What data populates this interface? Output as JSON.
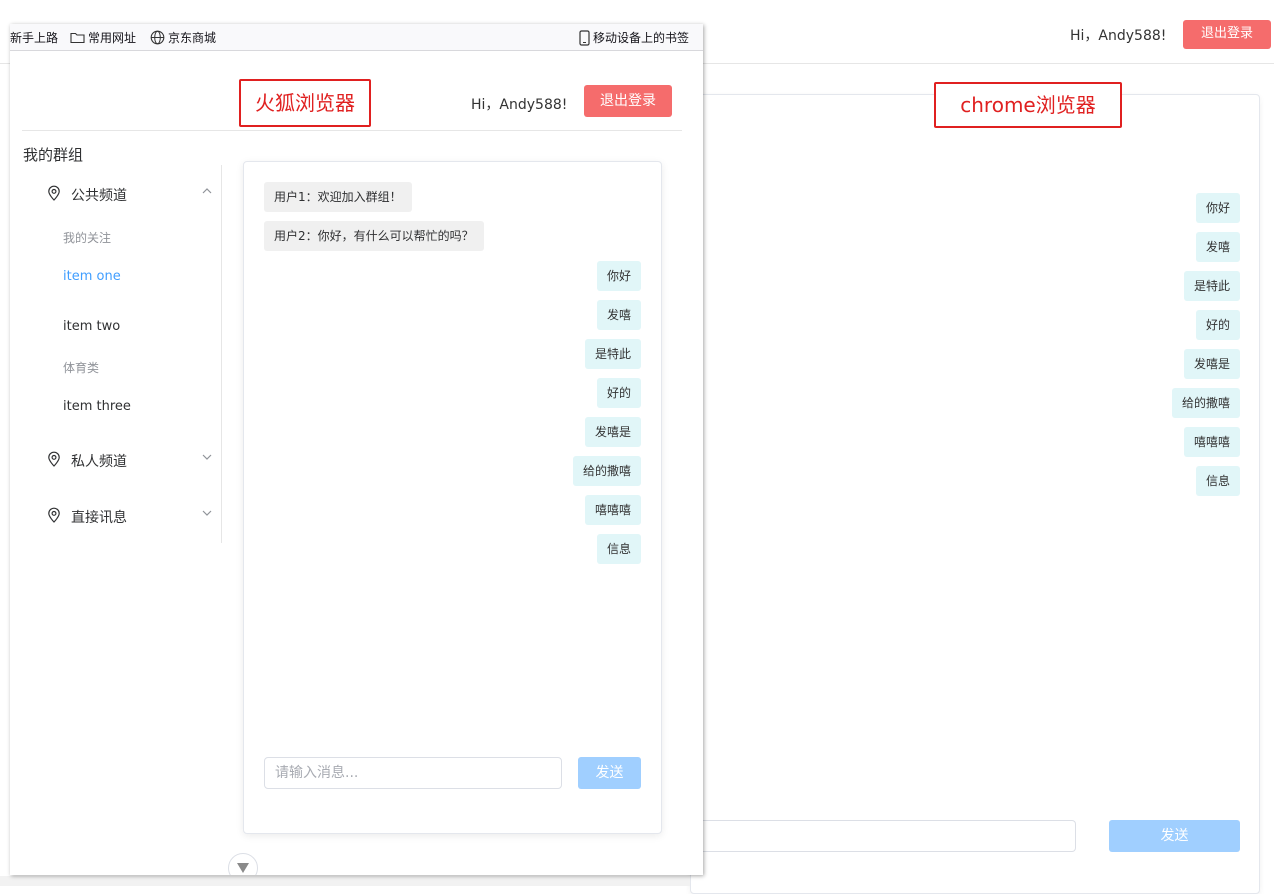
{
  "chrome": {
    "greeting": "Hi，Andy588!",
    "logout_label": "退出登录",
    "annotation": "chrome浏览器",
    "messages_right": [
      "你好",
      "发嘻",
      "是特此",
      "好的",
      "发嘻是",
      "给的撒嘻",
      "嘻嘻嘻",
      "信息"
    ],
    "send_label": "发送"
  },
  "firefox": {
    "bookmarks": [
      "新手上路",
      "常用网址",
      "京东商城",
      "移动设备上的书签"
    ],
    "annotation": "火狐浏览器",
    "greeting": "Hi，Andy588!",
    "logout_label": "退出登录",
    "group_title": "我的群组",
    "menu": {
      "public_channel": "公共频道",
      "group_follow": "我的关注",
      "item_one": "item one",
      "item_two": "item two",
      "group_sports": "体育类",
      "item_three": "item three",
      "private_channel": "私人频道",
      "direct_message": "直接讯息"
    },
    "messages_left": [
      "用户1：欢迎加入群组！",
      "用户2：你好，有什么可以帮忙的吗？"
    ],
    "messages_right": [
      "你好",
      "发嘻",
      "是特此",
      "好的",
      "发嘻是",
      "给的撒嘻",
      "嘻嘻嘻",
      "信息"
    ],
    "input_placeholder": "请输入消息...",
    "send_label": "发送"
  },
  "colors": {
    "accent": "#409eff",
    "danger": "#f56c6c",
    "bubble": "#e1f6f8",
    "send_disabled": "#a0cfff",
    "annotation": "#e02020"
  },
  "icons": [
    "folder-icon",
    "globe-icon",
    "mobile-icon",
    "location-pin-icon",
    "chevron-up-icon",
    "chevron-down-icon",
    "scroll-down-icon"
  ]
}
